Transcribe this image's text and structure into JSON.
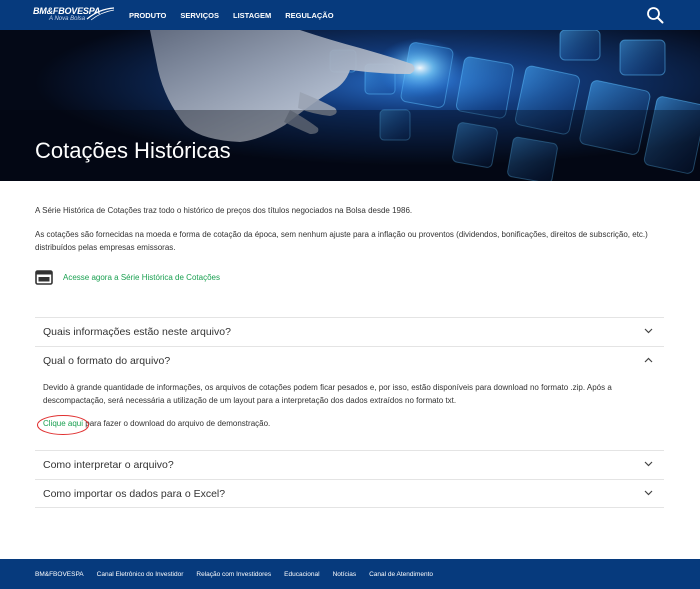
{
  "header": {
    "logo_text": "BM&FBOVESPA",
    "logo_subtext": "A Nova Bolsa",
    "nav": [
      "PRODUTO",
      "SERVIÇOS",
      "LISTAGEM",
      "REGULAÇÃO"
    ]
  },
  "hero": {
    "title": "Cotações Históricas"
  },
  "content": {
    "paragraph_1": "A Série Histórica de Cotações traz todo o histórico de preços dos títulos negociados na Bolsa desde 1986.",
    "paragraph_2": "As cotações são fornecidas na moeda e forma de cotação da época, sem nenhum ajuste para a inflação ou proventos (dividendos, bonificações, direitos de subscrição, etc.) distribuídos pelas empresas emissoras.",
    "series_link": "Acesse agora a Série Histórica de Cotações"
  },
  "accordion": [
    {
      "title": "Quais informações estão neste arquivo?",
      "expanded": false
    },
    {
      "title": "Qual o formato do arquivo?",
      "expanded": true,
      "body": "Devido à grande quantidade de informações, os arquivos de cotações podem ficar pesados e, por isso, estão disponíveis para download no formato .zip. Após a descompactação, será necessária a utilização de um layout para a interpretação dos dados extraídos no formato txt.",
      "link_text": "Clique aqui",
      "link_suffix": " para fazer o download do arquivo de demonstração."
    },
    {
      "title": "Como interpretar o arquivo?",
      "expanded": false
    },
    {
      "title": "Como importar os dados para o Excel?",
      "expanded": false
    }
  ],
  "footer": {
    "items": [
      "BM&FBOVESPA",
      "Canal Eletrônico do Investidor",
      "Relação com Investidores",
      "Educacional",
      "Notícias",
      "Canal de Atendimento"
    ]
  },
  "colors": {
    "header_bg": "#063a7d",
    "link_green": "#1aa051",
    "annotation_red": "#e03030"
  }
}
